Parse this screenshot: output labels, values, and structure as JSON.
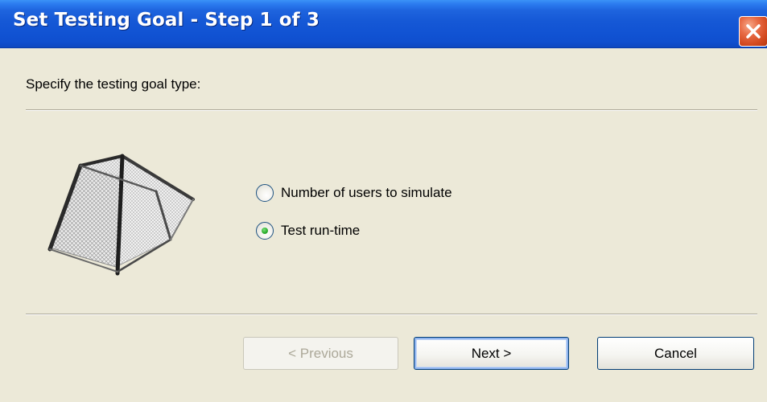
{
  "window": {
    "title": "Set Testing Goal - Step 1 of 3"
  },
  "icons": {
    "close": "close-icon",
    "goal": "soccer-goal-icon"
  },
  "colors": {
    "titlebar": "#1558D6",
    "dialog_background": "#ECE9D8",
    "close_button": "#D34A20",
    "radio_selected_dot": "#30B030",
    "disabled_text": "#ACA899"
  },
  "content": {
    "prompt": "Specify the testing goal type:",
    "options": [
      {
        "label": "Number of users to simulate",
        "selected": false
      },
      {
        "label": "Test run-time",
        "selected": true
      }
    ]
  },
  "buttons": {
    "previous": {
      "label": "< Previous",
      "enabled": false
    },
    "next": {
      "label": "Next >",
      "enabled": true
    },
    "cancel": {
      "label": "Cancel",
      "enabled": true
    }
  }
}
